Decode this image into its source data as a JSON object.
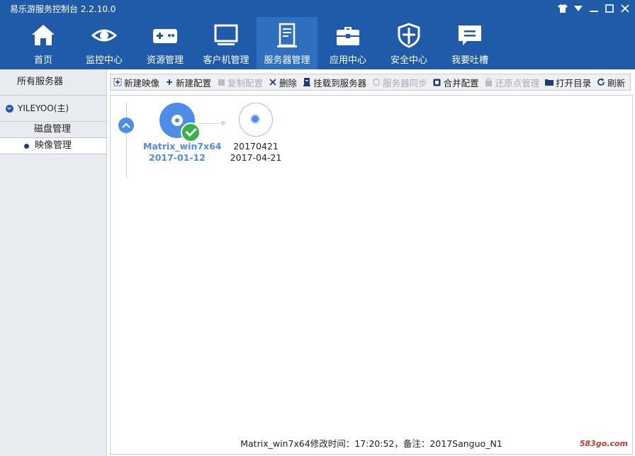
{
  "window": {
    "title": "易乐游服务控制台 2.2.10.0",
    "controls": [
      "shirt-icon",
      "menu-down-icon",
      "minimize-icon",
      "maximize-icon",
      "close-icon"
    ]
  },
  "nav": {
    "items": [
      {
        "label": "首页",
        "icon": "home-icon"
      },
      {
        "label": "监控中心",
        "icon": "eye-icon"
      },
      {
        "label": "资源管理",
        "icon": "gamepad-icon"
      },
      {
        "label": "客户机管理",
        "icon": "monitor-icon"
      },
      {
        "label": "服务器管理",
        "icon": "server-icon",
        "active": true
      },
      {
        "label": "应用中心",
        "icon": "toolbox-icon"
      },
      {
        "label": "安全中心",
        "icon": "shield-icon"
      },
      {
        "label": "我要吐槽",
        "icon": "chat-icon"
      }
    ]
  },
  "sidebar": {
    "all_servers": "所有服务器",
    "server_name": "YILEYOO(主)",
    "disk_mgmt": "磁盘管理",
    "image_mgmt": "映像管理"
  },
  "toolbar": {
    "items": [
      {
        "label": "新建映像",
        "icon": "new-image-icon",
        "enabled": true
      },
      {
        "label": "新建配置",
        "icon": "plus-icon",
        "enabled": true
      },
      {
        "label": "复制配置",
        "icon": "copy-icon",
        "enabled": false
      },
      {
        "label": "删除",
        "icon": "delete-icon",
        "enabled": true
      },
      {
        "label": "挂载到服务器",
        "icon": "mount-icon",
        "enabled": true
      },
      {
        "label": "服务器同步",
        "icon": "sync-icon",
        "enabled": false
      },
      {
        "label": "合并配置",
        "icon": "merge-icon",
        "enabled": true
      },
      {
        "label": "还原点管理",
        "icon": "restore-icon",
        "enabled": false
      },
      {
        "label": "打开目录",
        "icon": "folder-icon",
        "enabled": true
      },
      {
        "label": "刷新",
        "icon": "refresh-icon",
        "enabled": true
      }
    ]
  },
  "images": {
    "base": {
      "name": "Matrix_win7x64",
      "date": "2017-01-12"
    },
    "snapshot": {
      "name": "20170421",
      "date": "2017-04-21"
    }
  },
  "status": "Matrix_win7x64修改时间：17:20:52，备注：2017Sanguo_N1",
  "watermark": "583go.com",
  "colors": {
    "header": "#1f5ba8",
    "accent": "#4d8de8",
    "ok": "#36b24a"
  }
}
